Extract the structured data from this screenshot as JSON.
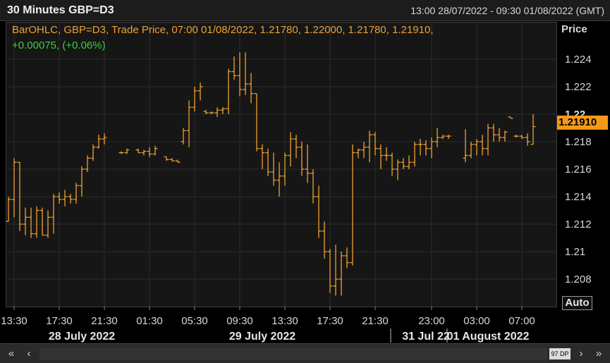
{
  "header": {
    "title": "30 Minutes GBP=D3",
    "range": "13:00 28/07/2022 - 09:30 01/08/2022 (GMT)"
  },
  "legend": {
    "line1": "BarOHLC, GBP=D3, Trade Price, 07:00 01/08/2022, 1.21780, 1.22000, 1.21780, 1.21910,",
    "line2": "+0.00075, (+0.06%)"
  },
  "axis": {
    "title": "Price",
    "last_price": "1.21910",
    "auto_label": "Auto"
  },
  "scrollbar": {
    "data_points": "97 DP"
  },
  "colors": {
    "bars": "#f0a030",
    "change_positive": "#3ccf3c",
    "last_price_bg": "#f59a18",
    "grid": "#2c2c2c",
    "plot_bg": "#161616"
  },
  "chart_data": {
    "type": "bar",
    "subtype": "ohlc",
    "ylim": [
      1.2065,
      1.2255
    ],
    "yticks": [
      1.208,
      1.21,
      1.212,
      1.214,
      1.216,
      1.218,
      1.22,
      1.222,
      1.224
    ],
    "ytick_labels": [
      "1.208",
      "1.21",
      "1.212",
      "1.214",
      "1.216",
      "1.218",
      "1.22",
      "1.222",
      "1.224"
    ],
    "x_tick_labels": [
      {
        "label": "13:30",
        "slot": 1
      },
      {
        "label": "17:30",
        "slot": 9
      },
      {
        "label": "21:30",
        "slot": 17
      },
      {
        "label": "01:30",
        "slot": 25
      },
      {
        "label": "05:30",
        "slot": 33
      },
      {
        "label": "09:30",
        "slot": 41
      },
      {
        "label": "13:30",
        "slot": 49
      },
      {
        "label": "17:30",
        "slot": 57
      },
      {
        "label": "21:30",
        "slot": 65
      },
      {
        "label": "23:00",
        "slot": 75
      },
      {
        "label": "03:00",
        "slot": 83
      },
      {
        "label": "07:00",
        "slot": 91
      }
    ],
    "date_labels": [
      {
        "label": "28 July 2022",
        "slot": 13,
        "separator_slot": null
      },
      {
        "label": "29 July 2022",
        "slot": 45,
        "separator_slot": 68
      },
      {
        "label": "31 Jul 22",
        "slot": 74,
        "separator_slot": 78
      },
      {
        "label": "01 August 2022",
        "slot": 85,
        "separator_slot": null
      }
    ],
    "slot_count": 93,
    "bars": [
      {
        "slot": 0,
        "o": 1.2122,
        "h": 1.214,
        "l": 1.2122,
        "c": 1.2138
      },
      {
        "slot": 1,
        "o": 1.2138,
        "h": 1.2168,
        "l": 1.2125,
        "c": 1.2165
      },
      {
        "slot": 2,
        "o": 1.2165,
        "h": 1.2165,
        "l": 1.2115,
        "c": 1.212
      },
      {
        "slot": 3,
        "o": 1.212,
        "h": 1.2132,
        "l": 1.2112,
        "c": 1.2125
      },
      {
        "slot": 4,
        "o": 1.2125,
        "h": 1.2132,
        "l": 1.211,
        "c": 1.2113
      },
      {
        "slot": 5,
        "o": 1.2113,
        "h": 1.2133,
        "l": 1.211,
        "c": 1.213
      },
      {
        "slot": 6,
        "o": 1.213,
        "h": 1.2132,
        "l": 1.2112,
        "c": 1.2112
      },
      {
        "slot": 7,
        "o": 1.2112,
        "h": 1.213,
        "l": 1.211,
        "c": 1.2125
      },
      {
        "slot": 8,
        "o": 1.2125,
        "h": 1.2142,
        "l": 1.2113,
        "c": 1.214
      },
      {
        "slot": 9,
        "o": 1.214,
        "h": 1.2143,
        "l": 1.2135,
        "c": 1.2138
      },
      {
        "slot": 10,
        "o": 1.2138,
        "h": 1.2145,
        "l": 1.2133,
        "c": 1.214
      },
      {
        "slot": 11,
        "o": 1.214,
        "h": 1.2142,
        "l": 1.2135,
        "c": 1.2138
      },
      {
        "slot": 12,
        "o": 1.2138,
        "h": 1.215,
        "l": 1.2135,
        "c": 1.2148
      },
      {
        "slot": 13,
        "o": 1.2148,
        "h": 1.2162,
        "l": 1.214,
        "c": 1.216
      },
      {
        "slot": 14,
        "o": 1.216,
        "h": 1.217,
        "l": 1.2158,
        "c": 1.2168
      },
      {
        "slot": 15,
        "o": 1.2168,
        "h": 1.2178,
        "l": 1.2166,
        "c": 1.2176
      },
      {
        "slot": 16,
        "o": 1.2176,
        "h": 1.2185,
        "l": 1.2175,
        "c": 1.2182
      },
      {
        "slot": 17,
        "o": 1.2182,
        "h": 1.2186,
        "l": 1.2178,
        "c": 1.2183
      },
      {
        "slot": 20,
        "o": 1.2172,
        "h": 1.2173,
        "l": 1.2171,
        "c": 1.2172
      },
      {
        "slot": 21,
        "o": 1.2172,
        "h": 1.2175,
        "l": 1.2171,
        "c": 1.2174
      },
      {
        "slot": 23,
        "o": 1.2174,
        "h": 1.2175,
        "l": 1.2172,
        "c": 1.2172
      },
      {
        "slot": 24,
        "o": 1.2172,
        "h": 1.2174,
        "l": 1.217,
        "c": 1.2173
      },
      {
        "slot": 25,
        "o": 1.2173,
        "h": 1.2176,
        "l": 1.2169,
        "c": 1.2171
      },
      {
        "slot": 26,
        "o": 1.2171,
        "h": 1.2177,
        "l": 1.217,
        "c": 1.2175
      },
      {
        "slot": 28,
        "o": 1.2169,
        "h": 1.2169,
        "l": 1.2166,
        "c": 1.2167
      },
      {
        "slot": 29,
        "o": 1.2167,
        "h": 1.2168,
        "l": 1.2166,
        "c": 1.2166
      },
      {
        "slot": 30,
        "o": 1.2166,
        "h": 1.2167,
        "l": 1.2165,
        "c": 1.2165
      },
      {
        "slot": 31,
        "o": 1.218,
        "h": 1.219,
        "l": 1.2178,
        "c": 1.2188
      },
      {
        "slot": 32,
        "o": 1.2188,
        "h": 1.221,
        "l": 1.2176,
        "c": 1.2205
      },
      {
        "slot": 33,
        "o": 1.2205,
        "h": 1.222,
        "l": 1.2202,
        "c": 1.2217
      },
      {
        "slot": 34,
        "o": 1.2217,
        "h": 1.2223,
        "l": 1.221,
        "c": 1.222
      },
      {
        "slot": 35,
        "o": 1.2202,
        "h": 1.2203,
        "l": 1.22,
        "c": 1.2201
      },
      {
        "slot": 36,
        "o": 1.2201,
        "h": 1.2202,
        "l": 1.22,
        "c": 1.2201
      },
      {
        "slot": 37,
        "o": 1.2201,
        "h": 1.2205,
        "l": 1.2198,
        "c": 1.2203
      },
      {
        "slot": 38,
        "o": 1.2203,
        "h": 1.2205,
        "l": 1.22,
        "c": 1.2204
      },
      {
        "slot": 39,
        "o": 1.2204,
        "h": 1.2233,
        "l": 1.22,
        "c": 1.2231
      },
      {
        "slot": 40,
        "o": 1.2231,
        "h": 1.2242,
        "l": 1.2225,
        "c": 1.2228
      },
      {
        "slot": 41,
        "o": 1.2228,
        "h": 1.2245,
        "l": 1.2213,
        "c": 1.2218
      },
      {
        "slot": 42,
        "o": 1.2218,
        "h": 1.2245,
        "l": 1.2214,
        "c": 1.2222
      },
      {
        "slot": 43,
        "o": 1.2222,
        "h": 1.223,
        "l": 1.2208,
        "c": 1.2215
      },
      {
        "slot": 44,
        "o": 1.2215,
        "h": 1.2215,
        "l": 1.2173,
        "c": 1.2175
      },
      {
        "slot": 45,
        "o": 1.2175,
        "h": 1.2178,
        "l": 1.216,
        "c": 1.2172
      },
      {
        "slot": 46,
        "o": 1.2172,
        "h": 1.2175,
        "l": 1.2155,
        "c": 1.2158
      },
      {
        "slot": 47,
        "o": 1.2158,
        "h": 1.2172,
        "l": 1.2148,
        "c": 1.2152
      },
      {
        "slot": 48,
        "o": 1.2152,
        "h": 1.2165,
        "l": 1.214,
        "c": 1.2155
      },
      {
        "slot": 49,
        "o": 1.2155,
        "h": 1.2172,
        "l": 1.2148,
        "c": 1.217
      },
      {
        "slot": 50,
        "o": 1.217,
        "h": 1.2187,
        "l": 1.2162,
        "c": 1.2182
      },
      {
        "slot": 51,
        "o": 1.2182,
        "h": 1.2185,
        "l": 1.2168,
        "c": 1.2176
      },
      {
        "slot": 52,
        "o": 1.2176,
        "h": 1.218,
        "l": 1.2155,
        "c": 1.216
      },
      {
        "slot": 53,
        "o": 1.216,
        "h": 1.2178,
        "l": 1.215,
        "c": 1.2157
      },
      {
        "slot": 54,
        "o": 1.2157,
        "h": 1.216,
        "l": 1.2135,
        "c": 1.214
      },
      {
        "slot": 55,
        "o": 1.214,
        "h": 1.2148,
        "l": 1.211,
        "c": 1.2115
      },
      {
        "slot": 56,
        "o": 1.2115,
        "h": 1.2122,
        "l": 1.2095,
        "c": 1.21
      },
      {
        "slot": 57,
        "o": 1.21,
        "h": 1.2102,
        "l": 1.207,
        "c": 1.2075
      },
      {
        "slot": 58,
        "o": 1.2075,
        "h": 1.2105,
        "l": 1.2068,
        "c": 1.208
      },
      {
        "slot": 59,
        "o": 1.208,
        "h": 1.21,
        "l": 1.2068,
        "c": 1.2097
      },
      {
        "slot": 60,
        "o": 1.2097,
        "h": 1.2103,
        "l": 1.2088,
        "c": 1.2092
      },
      {
        "slot": 61,
        "o": 1.2092,
        "h": 1.2178,
        "l": 1.209,
        "c": 1.2172
      },
      {
        "slot": 62,
        "o": 1.2172,
        "h": 1.2175,
        "l": 1.2168,
        "c": 1.2174
      },
      {
        "slot": 63,
        "o": 1.2174,
        "h": 1.218,
        "l": 1.2168,
        "c": 1.2176
      },
      {
        "slot": 64,
        "o": 1.2176,
        "h": 1.2188,
        "l": 1.2165,
        "c": 1.2185
      },
      {
        "slot": 65,
        "o": 1.2185,
        "h": 1.2187,
        "l": 1.217,
        "c": 1.2175
      },
      {
        "slot": 66,
        "o": 1.2175,
        "h": 1.2178,
        "l": 1.216,
        "c": 1.217
      },
      {
        "slot": 67,
        "o": 1.217,
        "h": 1.2176,
        "l": 1.2166,
        "c": 1.217
      },
      {
        "slot": 68,
        "o": 1.217,
        "h": 1.2172,
        "l": 1.2155,
        "c": 1.216
      },
      {
        "slot": 69,
        "o": 1.216,
        "h": 1.2167,
        "l": 1.2152,
        "c": 1.2165
      },
      {
        "slot": 70,
        "o": 1.2165,
        "h": 1.2168,
        "l": 1.216,
        "c": 1.2162
      },
      {
        "slot": 71,
        "o": 1.2162,
        "h": 1.217,
        "l": 1.216,
        "c": 1.2165
      },
      {
        "slot": 72,
        "o": 1.2165,
        "h": 1.218,
        "l": 1.2162,
        "c": 1.2178
      },
      {
        "slot": 73,
        "o": 1.2178,
        "h": 1.2182,
        "l": 1.217,
        "c": 1.2178
      },
      {
        "slot": 74,
        "o": 1.2178,
        "h": 1.2181,
        "l": 1.217,
        "c": 1.2175
      },
      {
        "slot": 75,
        "o": 1.2175,
        "h": 1.2183,
        "l": 1.2168,
        "c": 1.218
      },
      {
        "slot": 76,
        "o": 1.218,
        "h": 1.219,
        "l": 1.2176,
        "c": 1.2183
      },
      {
        "slot": 77,
        "o": 1.2183,
        "h": 1.2185,
        "l": 1.2182,
        "c": 1.2184
      },
      {
        "slot": 78,
        "o": 1.2184,
        "h": 1.2185,
        "l": 1.2182,
        "c": 1.2184
      },
      {
        "slot": 81,
        "o": 1.2168,
        "h": 1.2189,
        "l": 1.2165,
        "c": 1.217
      },
      {
        "slot": 82,
        "o": 1.217,
        "h": 1.218,
        "l": 1.2168,
        "c": 1.2178
      },
      {
        "slot": 83,
        "o": 1.2178,
        "h": 1.2182,
        "l": 1.217,
        "c": 1.218
      },
      {
        "slot": 84,
        "o": 1.218,
        "h": 1.2185,
        "l": 1.217,
        "c": 1.2175
      },
      {
        "slot": 85,
        "o": 1.2175,
        "h": 1.2193,
        "l": 1.217,
        "c": 1.219
      },
      {
        "slot": 86,
        "o": 1.219,
        "h": 1.2193,
        "l": 1.218,
        "c": 1.2185
      },
      {
        "slot": 87,
        "o": 1.2185,
        "h": 1.219,
        "l": 1.218,
        "c": 1.2183
      },
      {
        "slot": 88,
        "o": 1.2183,
        "h": 1.2188,
        "l": 1.218,
        "c": 1.2187
      },
      {
        "slot": 89,
        "o": 1.2198,
        "h": 1.2198,
        "l": 1.2197,
        "c": 1.2197
      },
      {
        "slot": 90,
        "o": 1.2184,
        "h": 1.2185,
        "l": 1.2183,
        "c": 1.2184
      },
      {
        "slot": 91,
        "o": 1.2184,
        "h": 1.2185,
        "l": 1.2182,
        "c": 1.2183
      },
      {
        "slot": 92,
        "o": 1.2183,
        "h": 1.2186,
        "l": 1.2177,
        "c": 1.218
      },
      {
        "slot": 93,
        "o": 1.2178,
        "h": 1.22,
        "l": 1.2178,
        "c": 1.2191
      }
    ]
  }
}
